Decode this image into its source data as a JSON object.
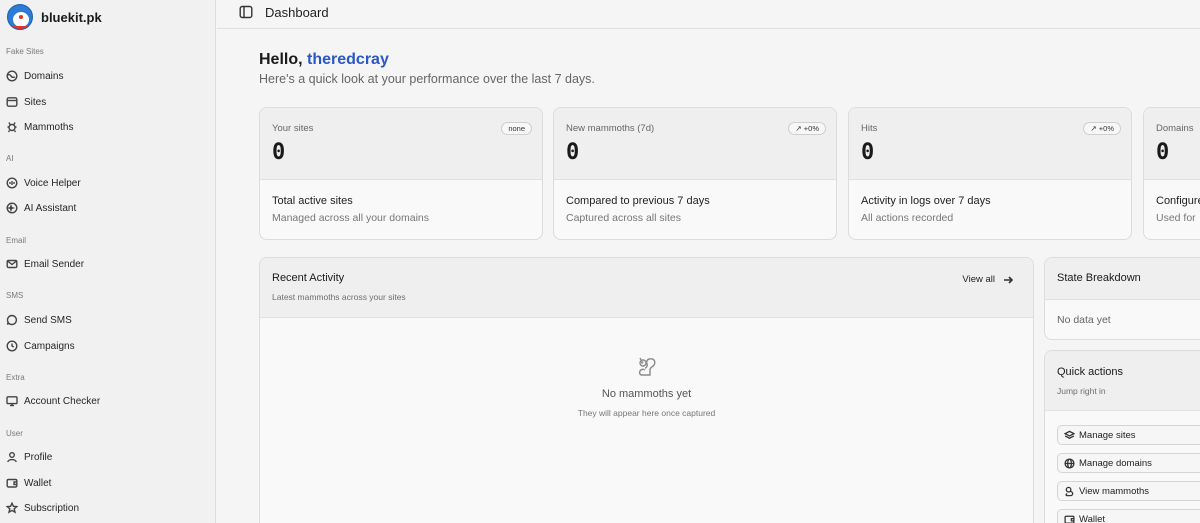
{
  "brand": {
    "name": "bluekit.pk"
  },
  "sidebar": {
    "sections": [
      {
        "label": "Fake Sites",
        "items": [
          {
            "label": "Domains",
            "icon": "domain-icon"
          },
          {
            "label": "Sites",
            "icon": "sites-icon"
          },
          {
            "label": "Mammoths",
            "icon": "mammoth-icon"
          }
        ]
      },
      {
        "label": "AI",
        "items": [
          {
            "label": "Voice Helper",
            "icon": "voice-icon"
          },
          {
            "label": "AI Assistant",
            "icon": "ai-icon"
          }
        ]
      },
      {
        "label": "Email",
        "items": [
          {
            "label": "Email Sender",
            "icon": "mail-icon"
          }
        ]
      },
      {
        "label": "SMS",
        "items": [
          {
            "label": "Send SMS",
            "icon": "sms-icon"
          },
          {
            "label": "Campaigns",
            "icon": "clock-icon"
          }
        ]
      },
      {
        "label": "Extra",
        "items": [
          {
            "label": "Account Checker",
            "icon": "monitor-icon"
          }
        ]
      },
      {
        "label": "User",
        "items": [
          {
            "label": "Profile",
            "icon": "user-icon"
          },
          {
            "label": "Wallet",
            "icon": "wallet-icon"
          },
          {
            "label": "Subscription",
            "icon": "star-icon"
          }
        ]
      }
    ]
  },
  "topbar": {
    "title": "Dashboard"
  },
  "greeting": {
    "hello": "Hello,",
    "username": "theredcray",
    "subtitle": "Here's a quick look at your performance over the last 7 days."
  },
  "stats": [
    {
      "label": "Your sites",
      "badge": "none",
      "value": "0",
      "line1": "Total active sites",
      "line2": "Managed across all your domains"
    },
    {
      "label": "New mammoths (7d)",
      "badge": "+0%",
      "value": "0",
      "line1": "Compared to previous 7 days",
      "line2": "Captured across all sites"
    },
    {
      "label": "Hits",
      "badge": "+0%",
      "value": "0",
      "line1": "Activity in logs over 7 days",
      "line2": "All actions recorded"
    },
    {
      "label": "Domains",
      "badge": "",
      "value": "0",
      "line1": "Configure",
      "line2": "Used for"
    }
  ],
  "recent": {
    "title": "Recent Activity",
    "subtitle": "Latest mammoths across your sites",
    "view_all": "View all",
    "empty_title": "No mammoths yet",
    "empty_sub": "They will appear here once captured"
  },
  "state": {
    "title": "State Breakdown",
    "empty": "No data yet"
  },
  "quick": {
    "title": "Quick actions",
    "subtitle": "Jump right in",
    "buttons": [
      {
        "label": "Manage sites",
        "icon": "layers-icon"
      },
      {
        "label": "Manage domains",
        "icon": "globe-icon"
      },
      {
        "label": "View mammoths",
        "icon": "mammoth-icon"
      },
      {
        "label": "Wallet",
        "icon": "wallet-icon"
      }
    ]
  }
}
